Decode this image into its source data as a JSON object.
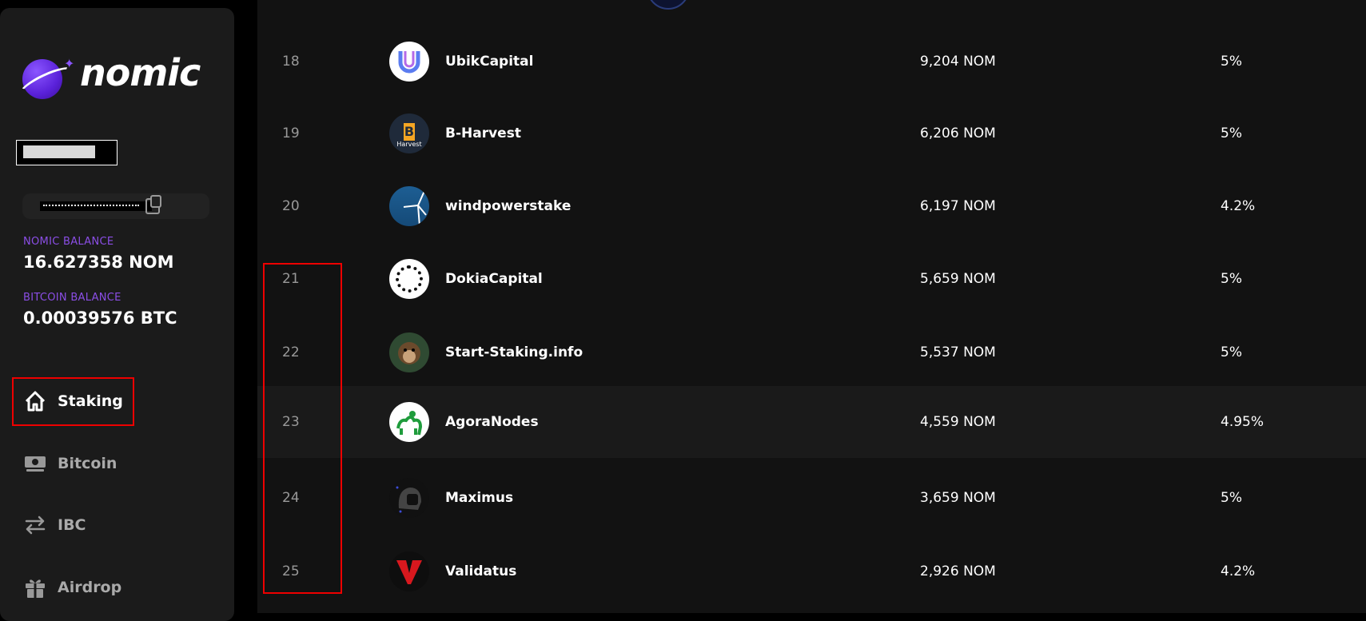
{
  "app": {
    "brand": "nomic",
    "accent": "#8b4ee6"
  },
  "balances": {
    "nomic_label": "NOMIC BALANCE",
    "nomic_value": "16.627358 NOM",
    "btc_label": "BITCOIN BALANCE",
    "btc_value": "0.00039576 BTC"
  },
  "nav": [
    {
      "label": "Staking",
      "icon": "home-icon",
      "active": true
    },
    {
      "label": "Bitcoin",
      "icon": "bitcoin-money-icon",
      "active": false
    },
    {
      "label": "IBC",
      "icon": "swap-arrows-icon",
      "active": false
    },
    {
      "label": "Airdrop",
      "icon": "gift-icon",
      "active": false
    }
  ],
  "validators": [
    {
      "rank": "18",
      "name": "UbikCapital",
      "power": "9,204 NOM",
      "commission": "5%"
    },
    {
      "rank": "19",
      "name": "B-Harvest",
      "power": "6,206 NOM",
      "commission": "5%"
    },
    {
      "rank": "20",
      "name": "windpowerstake",
      "power": "6,197 NOM",
      "commission": "4.2%"
    },
    {
      "rank": "21",
      "name": "DokiaCapital",
      "power": "5,659 NOM",
      "commission": "5%"
    },
    {
      "rank": "22",
      "name": "Start-Staking.info",
      "power": "5,537 NOM",
      "commission": "5%"
    },
    {
      "rank": "23",
      "name": "AgoraNodes",
      "power": "4,559 NOM",
      "commission": "4.95%"
    },
    {
      "rank": "24",
      "name": "Maximus",
      "power": "3,659 NOM",
      "commission": "5%"
    },
    {
      "rank": "25",
      "name": "Validatus",
      "power": "2,926 NOM",
      "commission": "4.2%"
    }
  ],
  "avatar_text": {
    "bharvest": "Harvest"
  }
}
